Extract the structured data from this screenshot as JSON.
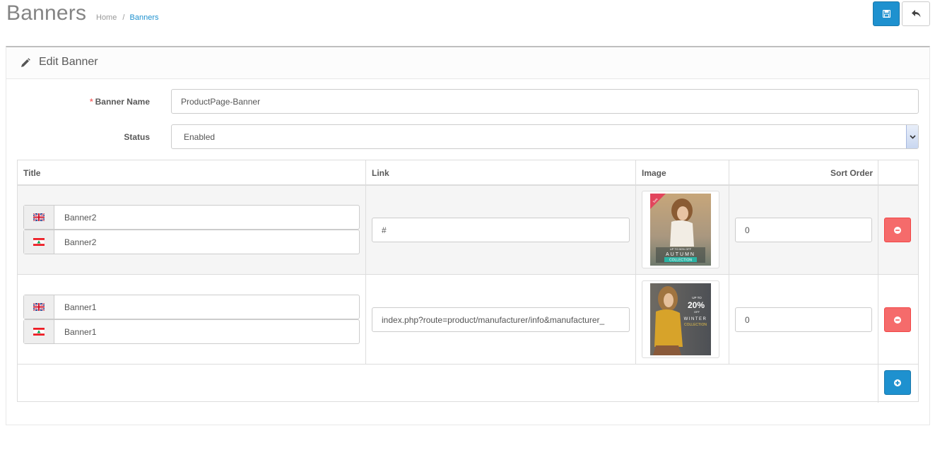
{
  "page": {
    "title": "Banners",
    "breadcrumb": [
      {
        "label": "Home"
      },
      {
        "label": "Banners"
      }
    ],
    "buttons": {
      "save_icon": "save-icon",
      "back_icon": "reply-icon"
    }
  },
  "panel": {
    "title": "Edit Banner",
    "title_icon": "pencil-icon"
  },
  "form": {
    "name": {
      "required_mark": "*",
      "label": "Banner Name",
      "value": "ProductPage-Banner"
    },
    "status": {
      "label": "Status",
      "value": "Enabled"
    }
  },
  "table": {
    "headers": {
      "title": "Title",
      "link": "Link",
      "image": "Image",
      "sort_order": "Sort Order"
    },
    "rows": [
      {
        "titles": [
          {
            "flag": "uk-flag-icon",
            "value": "Banner2"
          },
          {
            "flag": "lebanon-flag-icon",
            "value": "Banner2"
          }
        ],
        "link": "#",
        "image": {
          "top_badge": "Sale",
          "line1": "UP TO 50% OFF",
          "line2": "AUTUMN",
          "line3": "COLLECTION"
        },
        "sort_order": "0"
      },
      {
        "titles": [
          {
            "flag": "uk-flag-icon",
            "value": "Banner1"
          },
          {
            "flag": "lebanon-flag-icon",
            "value": "Banner1"
          }
        ],
        "link": "index.php?route=product/manufacturer/info&manufacturer_",
        "image": {
          "line1": "UP TO",
          "line2": "20%",
          "line3": "OFF",
          "line4": "WINTER",
          "line5": "COLLECTION"
        },
        "sort_order": "0"
      }
    ]
  },
  "colors": {
    "primary": "#1e91cf",
    "danger": "#f56b6b",
    "required": "#f56b6b"
  }
}
